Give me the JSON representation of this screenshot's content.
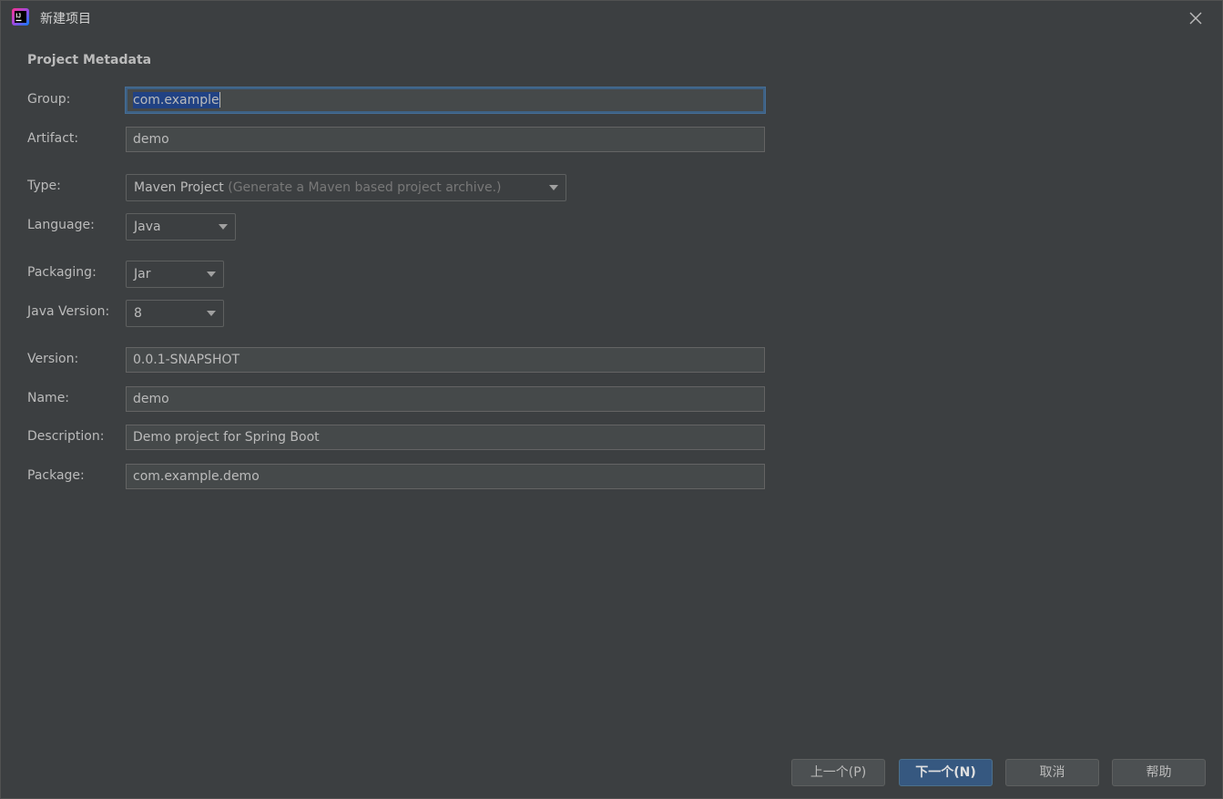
{
  "window": {
    "title": "新建项目",
    "app_icon": "intellij-idea-icon",
    "close_icon": "close-icon"
  },
  "form": {
    "section_title": "Project Metadata",
    "group": {
      "label": "Group:",
      "value": "com.example"
    },
    "artifact": {
      "label": "Artifact:",
      "value": "demo"
    },
    "type": {
      "label": "Type:",
      "value": "Maven Project",
      "hint": "(Generate a Maven based project archive.)"
    },
    "language": {
      "label": "Language:",
      "value": "Java"
    },
    "packaging": {
      "label": "Packaging:",
      "value": "Jar"
    },
    "java_version": {
      "label": "Java Version:",
      "value": "8"
    },
    "version": {
      "label": "Version:",
      "value": "0.0.1-SNAPSHOT"
    },
    "name": {
      "label": "Name:",
      "value": "demo"
    },
    "description": {
      "label": "Description:",
      "value": "Demo project for Spring Boot"
    },
    "package": {
      "label": "Package:",
      "value": "com.example.demo"
    }
  },
  "buttons": {
    "previous": "上一个(P)",
    "next": "下一个(N)",
    "cancel": "取消",
    "help": "帮助"
  },
  "colors": {
    "background": "#3c3f41",
    "field_bg": "#45494a",
    "focus_border": "#3d6185",
    "primary_button": "#365880",
    "selection": "#214283"
  }
}
